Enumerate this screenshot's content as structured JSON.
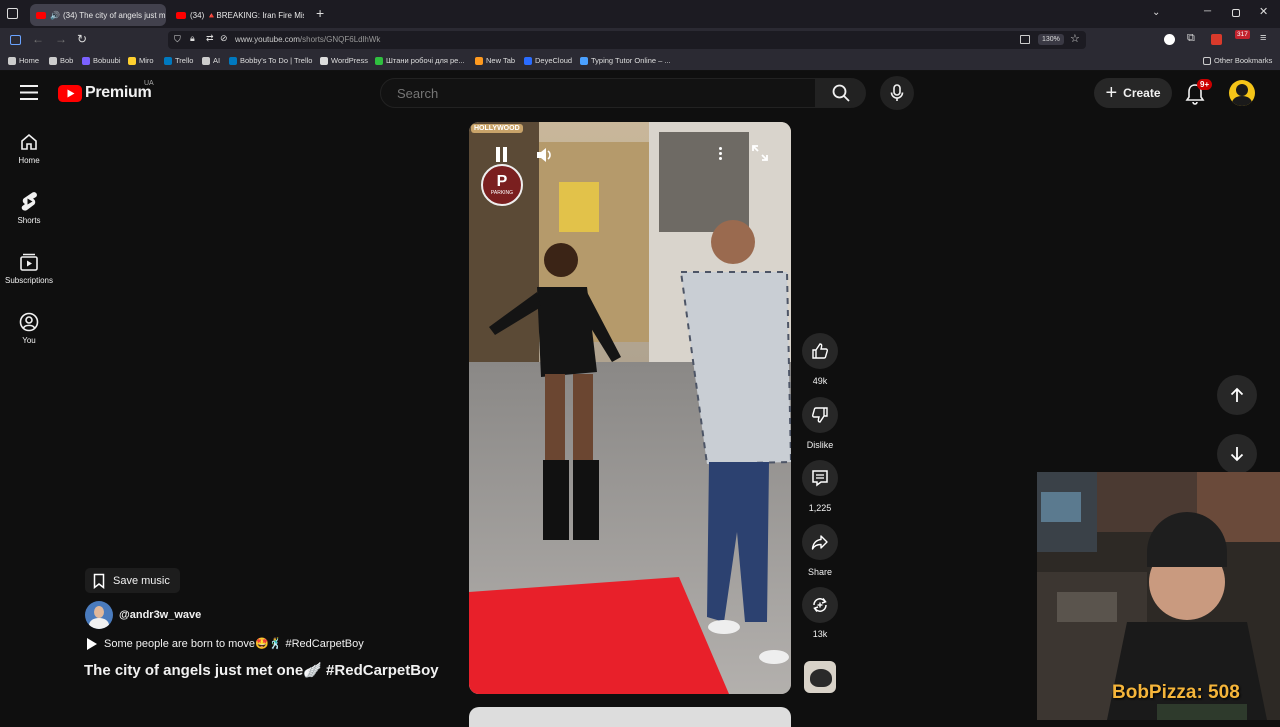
{
  "browser": {
    "tabs": [
      {
        "title": "(34) The city of angels just m",
        "active": true
      },
      {
        "title": "(34) 🔺BREAKING: Iran Fire Mis",
        "active": false
      }
    ],
    "url_host": "www.youtube.com",
    "url_path": "/shorts/GNQF6LdlhWk",
    "zoom": "130%",
    "badge_count": "317",
    "bookmarks": [
      {
        "label": "Home",
        "color": "#cccccc"
      },
      {
        "label": "Bob",
        "color": "#cccccc"
      },
      {
        "label": "Bobuubi",
        "color": "#7b61ff"
      },
      {
        "label": "Miro",
        "color": "#ffd02f"
      },
      {
        "label": "Trello",
        "color": "#0079bf"
      },
      {
        "label": "AI",
        "color": "#cccccc"
      },
      {
        "label": "Bobby's To Do | Trello",
        "color": "#0079bf"
      },
      {
        "label": "WordPress",
        "color": "#dddddd"
      },
      {
        "label": "Штани робочі для ре...",
        "color": "#2fbf3f"
      },
      {
        "label": "New Tab",
        "color": "#ff9a1f"
      },
      {
        "label": "DeyeCloud",
        "color": "#2a6cff"
      },
      {
        "label": "Typing Tutor Online – ...",
        "color": "#4aa0ff"
      }
    ],
    "other_bookmarks": "Other Bookmarks"
  },
  "header": {
    "logo_text": "Premium",
    "region": "UA",
    "search_placeholder": "Search",
    "create_label": "Create",
    "notification_count": "9+"
  },
  "sidebar": [
    {
      "label": "Home",
      "icon": "home-icon"
    },
    {
      "label": "Shorts",
      "icon": "shorts-icon"
    },
    {
      "label": "Subscriptions",
      "icon": "subscriptions-icon"
    },
    {
      "label": "You",
      "icon": "you-icon"
    }
  ],
  "video": {
    "sign_text": "HOLLYWOOD",
    "parking_letter": "P",
    "parking_text": "PARKING"
  },
  "actions": {
    "likes": "49k",
    "dislike_label": "Dislike",
    "comments": "1,225",
    "share_label": "Share",
    "remix": "13k"
  },
  "info": {
    "save_music_label": "Save music",
    "channel": "@andr3w_wave",
    "music": "Some people are born to move🤩🕺 #RedCarpetBoy",
    "title": "The city of angels just met one🪽 #RedCarpetBoy"
  },
  "overlay": {
    "stream_text": "BobPizza: 508"
  },
  "colors": {
    "accent_red": "#ff0000",
    "bg": "#0f0f0f",
    "carpet": "#e8202a",
    "overlay_text": "#f5b53a"
  }
}
